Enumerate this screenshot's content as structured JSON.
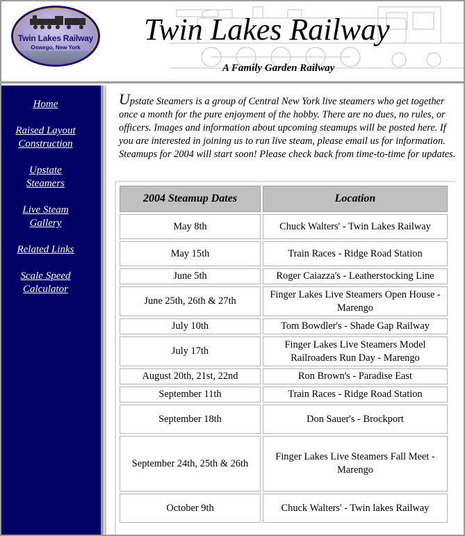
{
  "header": {
    "logo_title": "Twin Lakes Railway",
    "logo_subtitle": "Oswego, New York",
    "title": "Twin Lakes Railway",
    "tagline": "A Family Garden Railway"
  },
  "sidebar": {
    "items": [
      {
        "line1": "Home",
        "line2": ""
      },
      {
        "line1": "Raised Layout",
        "line2": "Construction"
      },
      {
        "line1": "Upstate",
        "line2": "Steamers"
      },
      {
        "line1": "Live Steam",
        "line2": "Gallery"
      },
      {
        "line1": "Related Links",
        "line2": ""
      },
      {
        "line1": "Scale Speed",
        "line2": "Calculator"
      }
    ]
  },
  "main": {
    "intro_initial": "U",
    "intro_text": "pstate Steamers is a group of Central New York live steamers who get together once a month for the pure enjoyment of the hobby.  There are no dues, no rules, or officers.  Images and information about upcoming steamups will be posted here.  If you are interested in joining us to run live steam, please email us for information.  Steamups for 2004 will start soon!  Please check back from time-to-time for updates.",
    "table": {
      "headers": [
        "2004 Steamup Dates",
        "Location"
      ],
      "rows": [
        {
          "date": "May 8th",
          "location": "Chuck Walters' - Twin Lakes Railway"
        },
        {
          "date": "May 15th",
          "location": "Train Races - Ridge Road Station"
        },
        {
          "date": "June 5th",
          "location": "Roger Caiazza's - Leatherstocking Line"
        },
        {
          "date": "June 25th, 26th & 27th",
          "location": "Finger Lakes Live Steamers Open House - Marengo"
        },
        {
          "date": "July 10th",
          "location": "Tom Bowdler's - Shade Gap Railway"
        },
        {
          "date": "July 17th",
          "location": "Finger Lakes Live Steamers Model Railroaders Run Day - Marengo"
        },
        {
          "date": "August 20th, 21st, 22nd",
          "location": "Ron Brown's - Paradise East"
        },
        {
          "date": "September 11th",
          "location": "Train Races - Ridge Road Station"
        },
        {
          "date": "September 18th",
          "location": "Don Sauer's -  Brockport"
        },
        {
          "date": "September 24th, 25th & 26th",
          "location": "Finger Lakes Live Steamers Fall Meet - Marengo"
        },
        {
          "date": "October 9th",
          "location": "Chuck Walters' - Twin lakes Railway"
        }
      ]
    }
  },
  "colors": {
    "sidebar_bg": "#000066",
    "header_cell_bg": "#c0c0c0",
    "logo_border": "#1a1470"
  }
}
